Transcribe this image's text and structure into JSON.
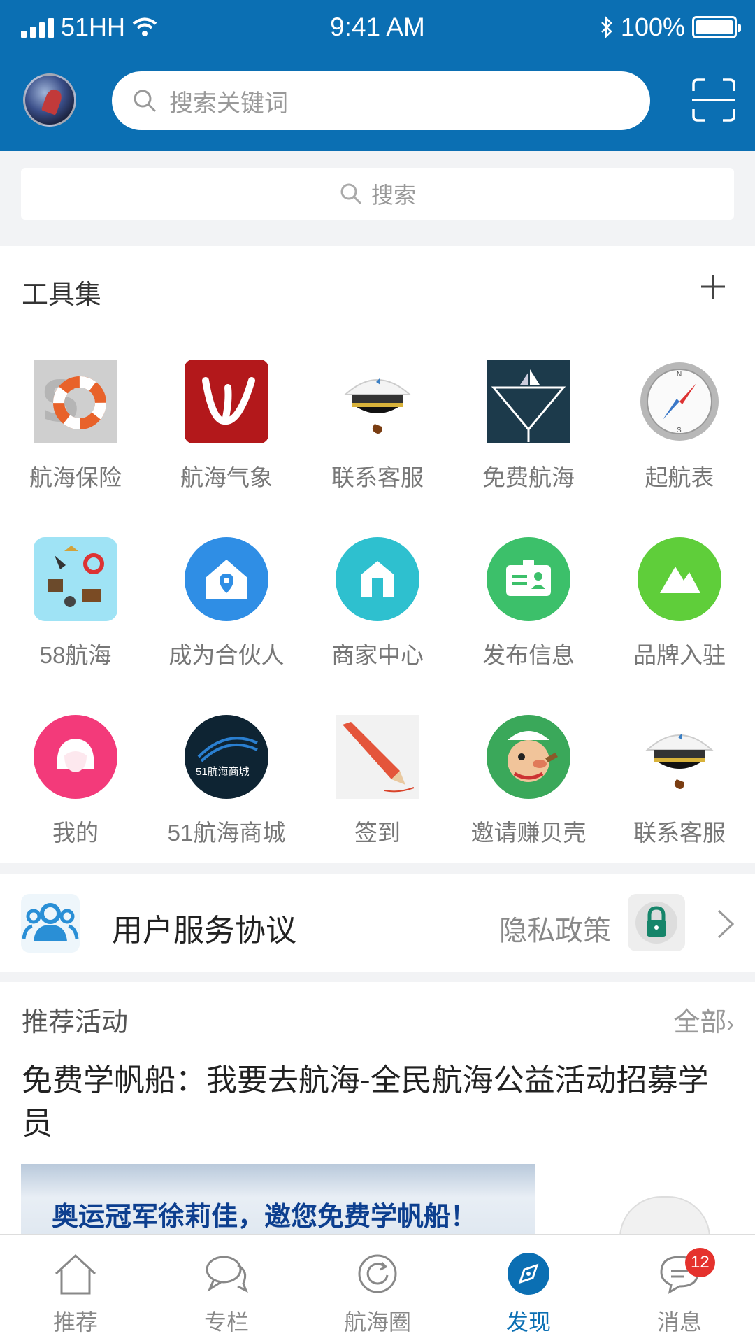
{
  "status_bar": {
    "carrier": "51HH",
    "time": "9:41 AM",
    "battery": "100%"
  },
  "header": {
    "search_placeholder": "搜索关键词"
  },
  "secondary_search": {
    "placeholder": "搜索"
  },
  "tools": {
    "title": "工具集",
    "items": [
      {
        "label": "航海保险",
        "icon": "lifebuoy-icon"
      },
      {
        "label": "航海气象",
        "icon": "weather-logo-icon"
      },
      {
        "label": "联系客服",
        "icon": "captain-hat-icon"
      },
      {
        "label": "免费航海",
        "icon": "sailboat-icon"
      },
      {
        "label": "起航表",
        "icon": "compass-icon"
      },
      {
        "label": "58航海",
        "icon": "pirate-items-icon"
      },
      {
        "label": "成为合伙人",
        "icon": "house-pin-icon"
      },
      {
        "label": "商家中心",
        "icon": "shop-icon"
      },
      {
        "label": "发布信息",
        "icon": "id-card-icon"
      },
      {
        "label": "品牌入驻",
        "icon": "mountain-icon"
      },
      {
        "label": "我的",
        "icon": "user-face-icon"
      },
      {
        "label": "51航海商城",
        "icon": "mall-logo-icon"
      },
      {
        "label": "签到",
        "icon": "pencil-icon"
      },
      {
        "label": "邀请赚贝壳",
        "icon": "popeye-icon"
      },
      {
        "label": "联系客服",
        "icon": "captain-hat-icon"
      }
    ],
    "mall_logo_text": "51航海商城"
  },
  "agreement": {
    "title": "用户服务协议",
    "privacy": "隐私政策"
  },
  "recommend": {
    "title": "推荐活动",
    "all": "全部",
    "headline": "免费学帆船：我要去航海-全民航海公益活动招募学员",
    "banner_text": "奥运冠军徐莉佳，邀您免费学帆船！"
  },
  "tabs": [
    {
      "label": "推荐",
      "icon": "home-icon"
    },
    {
      "label": "专栏",
      "icon": "chat-icon"
    },
    {
      "label": "航海圈",
      "icon": "refresh-circle-icon"
    },
    {
      "label": "发现",
      "icon": "compass-icon",
      "active": true
    },
    {
      "label": "消息",
      "icon": "message-icon"
    }
  ],
  "message_badge": "12",
  "colors": {
    "brand": "#0b6fb3",
    "badge": "#e5322d"
  }
}
